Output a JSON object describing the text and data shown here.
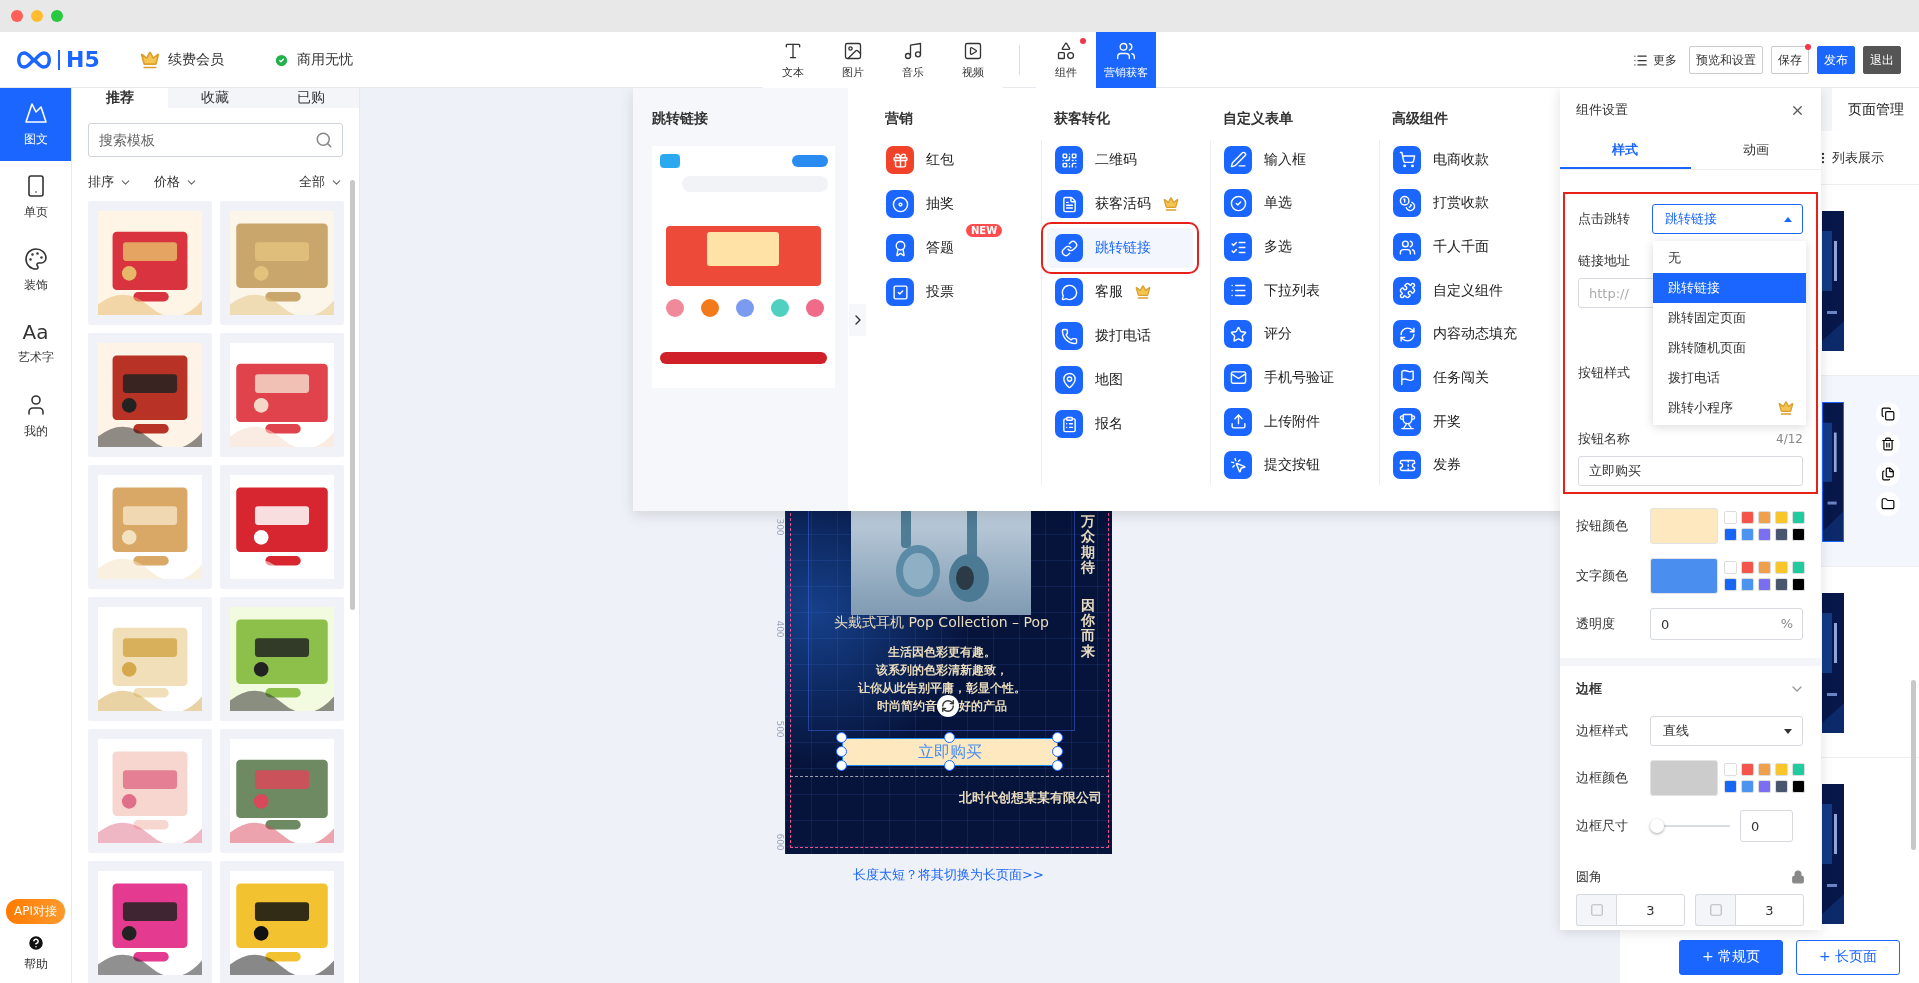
{
  "title_bar": {
    "controls": [
      {
        "color": "#ff5f57"
      },
      {
        "color": "#febc2e"
      },
      {
        "color": "#28c840"
      }
    ]
  },
  "header": {
    "logo": "H5",
    "member": "续费会员",
    "commercial": "商用无忧",
    "tool_groups": [
      {
        "items": [
          {
            "label": "文本",
            "selected": false,
            "dot": false
          },
          {
            "label": "图片",
            "selected": false,
            "dot": false
          },
          {
            "label": "音乐",
            "selected": false,
            "dot": false
          },
          {
            "label": "视频",
            "selected": false,
            "dot": false
          }
        ]
      },
      {
        "items": [
          {
            "label": "组件",
            "selected": false,
            "dot": true
          },
          {
            "label": "营销获客",
            "selected": true,
            "dot": false
          }
        ]
      }
    ],
    "more": "更多",
    "actions": [
      {
        "label": "预览和设置",
        "kind": "outline",
        "dot": false
      },
      {
        "label": "保存",
        "kind": "outline",
        "dot": true
      },
      {
        "label": "发布",
        "kind": "primary",
        "dot": false
      },
      {
        "label": "退出",
        "kind": "dark",
        "dot": false
      }
    ]
  },
  "rail": {
    "items": [
      {
        "label": "图文",
        "selected": true
      },
      {
        "label": "单页",
        "selected": false
      },
      {
        "label": "装饰",
        "selected": false
      },
      {
        "label": "艺术字",
        "selected": false,
        "glyph": "Aa"
      },
      {
        "label": "我的",
        "selected": false
      }
    ],
    "api_badge": "API对接",
    "help": "帮助"
  },
  "templates": {
    "tabs": [
      {
        "label": "推荐",
        "selected": true
      },
      {
        "label": "收藏",
        "selected": false
      },
      {
        "label": "已购",
        "selected": false
      }
    ],
    "search": {
      "placeholder": "搜索模板"
    },
    "filters": [
      "排序",
      "价格"
    ],
    "scope": "全部",
    "cards": [
      {
        "kind": "picture"
      },
      {
        "kind": "picture"
      },
      {
        "kind": "picture"
      },
      {
        "kind": "picture"
      },
      {
        "kind": "picture"
      },
      {
        "kind": "picture"
      },
      {
        "kind": "picture"
      },
      {
        "kind": "picture"
      },
      {
        "kind": "picture"
      },
      {
        "kind": "picture"
      },
      {
        "kind": "picture"
      },
      {
        "kind": "picture"
      }
    ]
  },
  "canvas": {
    "ruler": [
      "300",
      "400",
      "500",
      "600"
    ],
    "photo": {
      "kind": "picture"
    },
    "slogan": [
      "万众期待",
      "因你而来"
    ],
    "title": "头戴式耳机 Pop Collection – Pop",
    "description": [
      "生活因色彩更有趣。",
      "该系列的色彩清新趣致，",
      "让你从此告别平庸，彰显个性。"
    ],
    "last_line": [
      "时尚简约音",
      "好的产品"
    ],
    "button": {
      "label": "立即购买",
      "selected": true
    },
    "footer": "北时代创想某某有限公司",
    "hint": "长度太短？将其切换为长页面>>"
  },
  "pages": {
    "title": "页面管理",
    "view": "列表展示",
    "rows": [
      {
        "kind": "picture",
        "selected": false
      },
      {
        "kind": "picture",
        "selected": true
      },
      {
        "kind": "picture",
        "selected": false
      },
      {
        "kind": "picture",
        "selected": false
      }
    ],
    "add_buttons": [
      {
        "label": "+ 常规页",
        "kind": "primary"
      },
      {
        "label": "+ 长页面",
        "kind": "outline"
      }
    ]
  },
  "menu": {
    "preview_title": "跳转链接",
    "preview": {
      "kind": "picture"
    },
    "columns": [
      {
        "title": "营销",
        "items": [
          {
            "label": "红包",
            "selected": false
          },
          {
            "label": "抽奖",
            "selected": false
          },
          {
            "label": "答题",
            "selected": false,
            "badge": "NEW"
          },
          {
            "label": "投票",
            "selected": false
          }
        ]
      },
      {
        "title": "获客转化",
        "items": [
          {
            "label": "二维码",
            "selected": false
          },
          {
            "label": "获客活码",
            "selected": false,
            "premium": true
          },
          {
            "label": "跳转链接",
            "selected": true
          },
          {
            "label": "客服",
            "selected": false,
            "premium": true
          },
          {
            "label": "拨打电话",
            "selected": false
          },
          {
            "label": "地图",
            "selected": false
          },
          {
            "label": "报名",
            "selected": false
          }
        ]
      },
      {
        "title": "自定义表单",
        "items": [
          {
            "label": "输入框",
            "selected": false
          },
          {
            "label": "单选",
            "selected": false
          },
          {
            "label": "多选",
            "selected": false
          },
          {
            "label": "下拉列表",
            "selected": false
          },
          {
            "label": "评分",
            "selected": false
          },
          {
            "label": "手机号验证",
            "selected": false
          },
          {
            "label": "上传附件",
            "selected": false
          },
          {
            "label": "提交按钮",
            "selected": false
          }
        ]
      },
      {
        "title": "高级组件",
        "items": [
          {
            "label": "电商收款",
            "selected": false
          },
          {
            "label": "打赏收款",
            "selected": false
          },
          {
            "label": "千人千面",
            "selected": false
          },
          {
            "label": "自定义组件",
            "selected": false
          },
          {
            "label": "内容动态填充",
            "selected": false
          },
          {
            "label": "任务闯关",
            "selected": false
          },
          {
            "label": "开奖",
            "selected": false
          },
          {
            "label": "发券",
            "selected": false
          }
        ]
      }
    ]
  },
  "settings": {
    "title": "组件设置",
    "tabs": [
      {
        "label": "样式",
        "selected": true
      },
      {
        "label": "动画",
        "selected": false
      }
    ],
    "click_action": {
      "label": "点击跳转",
      "value": "跳转链接",
      "open": true,
      "options": [
        {
          "label": "无",
          "selected": false
        },
        {
          "label": "跳转链接",
          "selected": true
        },
        {
          "label": "跳转固定页面",
          "selected": false
        },
        {
          "label": "跳转随机页面",
          "selected": false
        },
        {
          "label": "拨打电话",
          "selected": false
        },
        {
          "label": "跳转小程序",
          "selected": false,
          "premium": true
        }
      ]
    },
    "link": {
      "label": "链接地址",
      "placeholder": "http://"
    },
    "button_style": {
      "label": "按钮样式"
    },
    "button_name": {
      "label": "按钮名称",
      "count": "4/12",
      "value": "立即购买"
    },
    "colors": [
      {
        "label": "按钮颜色",
        "color": "#fde8c0",
        "palette": [
          {
            "color": "#ffffff"
          },
          {
            "color": "#f5544a"
          },
          {
            "color": "#f0a04b"
          },
          {
            "color": "#f8c52b"
          },
          {
            "color": "#1fcc9e"
          },
          {
            "color": "#1766f5"
          },
          {
            "color": "#4d93f0"
          },
          {
            "color": "#7b6ef0"
          },
          {
            "color": "#4a5570"
          },
          {
            "color": "#000000"
          }
        ]
      },
      {
        "label": "文字颜色",
        "color": "#4a8ff0",
        "palette": [
          {
            "color": "#ffffff"
          },
          {
            "color": "#f5544a"
          },
          {
            "color": "#f0a04b"
          },
          {
            "color": "#f8c52b"
          },
          {
            "color": "#1fcc9e"
          },
          {
            "color": "#1766f5"
          },
          {
            "color": "#4d93f0"
          },
          {
            "color": "#7b6ef0"
          },
          {
            "color": "#4a5570"
          },
          {
            "color": "#000000"
          }
        ]
      }
    ],
    "opacity": {
      "label": "透明度",
      "value": "0",
      "unit": "%"
    },
    "border": {
      "title": "边框",
      "style": {
        "label": "边框样式",
        "value": "直线"
      },
      "color": {
        "label": "边框颜色",
        "color": "#cccccc",
        "palette": [
          {
            "color": "#ffffff"
          },
          {
            "color": "#f5544a"
          },
          {
            "color": "#f0a04b"
          },
          {
            "color": "#f8c52b"
          },
          {
            "color": "#1fcc9e"
          },
          {
            "color": "#1766f5"
          },
          {
            "color": "#4d93f0"
          },
          {
            "color": "#7b6ef0"
          },
          {
            "color": "#4a5570"
          },
          {
            "color": "#000000"
          }
        ]
      },
      "size": {
        "label": "边框尺寸",
        "level": 0,
        "value": "0"
      },
      "radius": {
        "label": "圆角",
        "corners": [
          "3",
          "3"
        ]
      }
    }
  }
}
